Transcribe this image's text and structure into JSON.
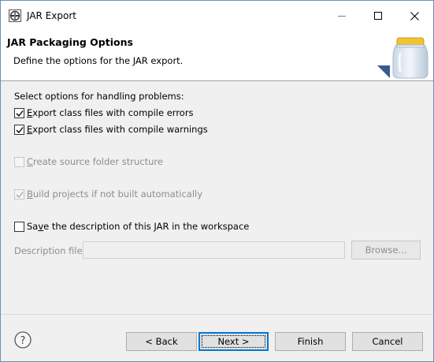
{
  "window": {
    "title": "JAR Export"
  },
  "banner": {
    "title": "JAR Packaging Options",
    "description": "Define the options for the JAR export."
  },
  "options": {
    "section_label": "Select options for handling problems:",
    "export_errors": {
      "label": "Export class files with compile errors",
      "mnemonic": "E",
      "checked": true,
      "enabled": true
    },
    "export_warnings": {
      "label": "Export class files with compile warnings",
      "mnemonic": "E",
      "checked": true,
      "enabled": true
    },
    "create_source_folder": {
      "label": "Create source folder structure",
      "mnemonic": "C",
      "checked": false,
      "enabled": false
    },
    "build_projects": {
      "label": "Build projects if not built automatically",
      "mnemonic": "B",
      "checked": true,
      "enabled": false
    },
    "save_description": {
      "label": "Save the description of this JAR in the workspace",
      "mnemonic": "v",
      "checked": false,
      "enabled": true
    }
  },
  "description_file": {
    "label": "Description file:",
    "value": "",
    "browse_label": "Browse..."
  },
  "footer": {
    "back_label": "< Back",
    "next_label": "Next >",
    "finish_label": "Finish",
    "cancel_label": "Cancel"
  },
  "icons": {
    "app": "eclipse-app-icon",
    "banner": "jar-icon",
    "help": "help-icon"
  },
  "colors": {
    "default_button_border": "#0078d7",
    "disabled_text": "#8d8d8d"
  }
}
